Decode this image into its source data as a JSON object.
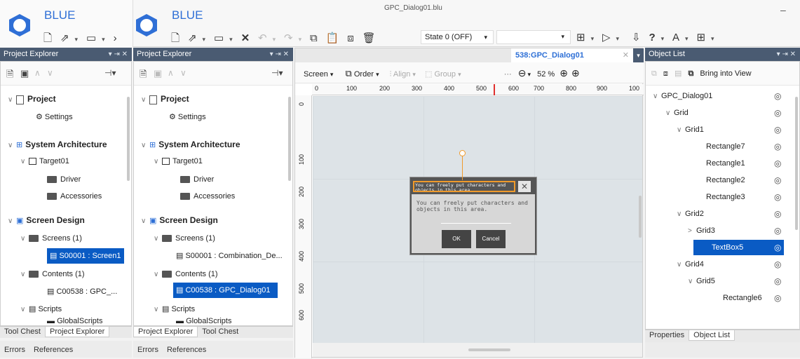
{
  "window": {
    "title": "GPC_Dialog01.blu",
    "minimize": "–"
  },
  "brand": "BLUE",
  "toolbar": {
    "state_label": "State 0 (OFF)",
    "help_label": "?",
    "icons": [
      "new-file-icon",
      "open-icon",
      "save-icon",
      "close-icon",
      "undo-icon",
      "redo-icon",
      "copy-icon",
      "paste-icon",
      "duplicate-icon",
      "delete-icon"
    ]
  },
  "left_panel": {
    "title": "Project Explorer",
    "tree": {
      "project": "Project",
      "settings": "Settings",
      "system_architecture": "System Architecture",
      "target": "Target01",
      "driver": "Driver",
      "accessories": "Accessories",
      "screen_design": "Screen Design",
      "screens": "Screens (1)",
      "screen_item": "S00001 : Screen1",
      "contents": "Contents (1)",
      "content_item": "C00538 : GPC_...",
      "scripts": "Scripts",
      "global_scripts": "GlobalScripts"
    },
    "tabs": [
      "Tool Chest",
      "Project Explorer"
    ],
    "bottom_tabs": [
      "Errors",
      "References"
    ]
  },
  "mid_panel": {
    "title": "Project Explorer",
    "tree": {
      "project": "Project",
      "settings": "Settings",
      "system_architecture": "System Architecture",
      "target": "Target01",
      "driver": "Driver",
      "accessories": "Accessories",
      "screen_design": "Screen Design",
      "screens": "Screens (1)",
      "screen_item": "S00001 : Combination_De...",
      "contents": "Contents (1)",
      "content_item": "C00538 : GPC_Dialog01",
      "scripts": "Scripts",
      "global_scripts": "GlobalScripts"
    },
    "tabs": [
      "Project Explorer",
      "Tool Chest"
    ],
    "bottom_tabs": [
      "Errors",
      "References"
    ]
  },
  "editor": {
    "tab_title": "538:GPC_Dialog01",
    "screen_label": "Screen",
    "order_label": "Order",
    "align_label": "Align",
    "group_label": "Group",
    "zoom": "52 %",
    "ruler_h": [
      "0",
      "100",
      "200",
      "300",
      "400",
      "500",
      "600",
      "700",
      "800",
      "900",
      "100"
    ],
    "ruler_v": [
      "0",
      "100",
      "200",
      "300",
      "400",
      "500",
      "600"
    ],
    "dialog": {
      "title_text": "You can freely put characters and objects in this area.",
      "body_text": "You can freely put characters and objects in this area.",
      "ok": "OK",
      "cancel": "Cancel"
    }
  },
  "right_panel": {
    "title": "Object List",
    "bring_label": "Bring into View",
    "items": [
      {
        "label": "GPC_Dialog01",
        "caret": "∨"
      },
      {
        "label": "Grid",
        "caret": "∨"
      },
      {
        "label": "Grid1",
        "caret": "∨"
      },
      {
        "label": "Rectangle7",
        "caret": ""
      },
      {
        "label": "Rectangle1",
        "caret": ""
      },
      {
        "label": "Rectangle2",
        "caret": ""
      },
      {
        "label": "Rectangle3",
        "caret": ""
      },
      {
        "label": "Grid2",
        "caret": "∨"
      },
      {
        "label": "Grid3",
        "caret": ">"
      },
      {
        "label": "TextBox5",
        "caret": ""
      },
      {
        "label": "Grid4",
        "caret": "∨"
      },
      {
        "label": "Grid5",
        "caret": "∨"
      },
      {
        "label": "Rectangle6",
        "caret": ""
      }
    ],
    "tabs": [
      "Properties",
      "Object List"
    ]
  }
}
